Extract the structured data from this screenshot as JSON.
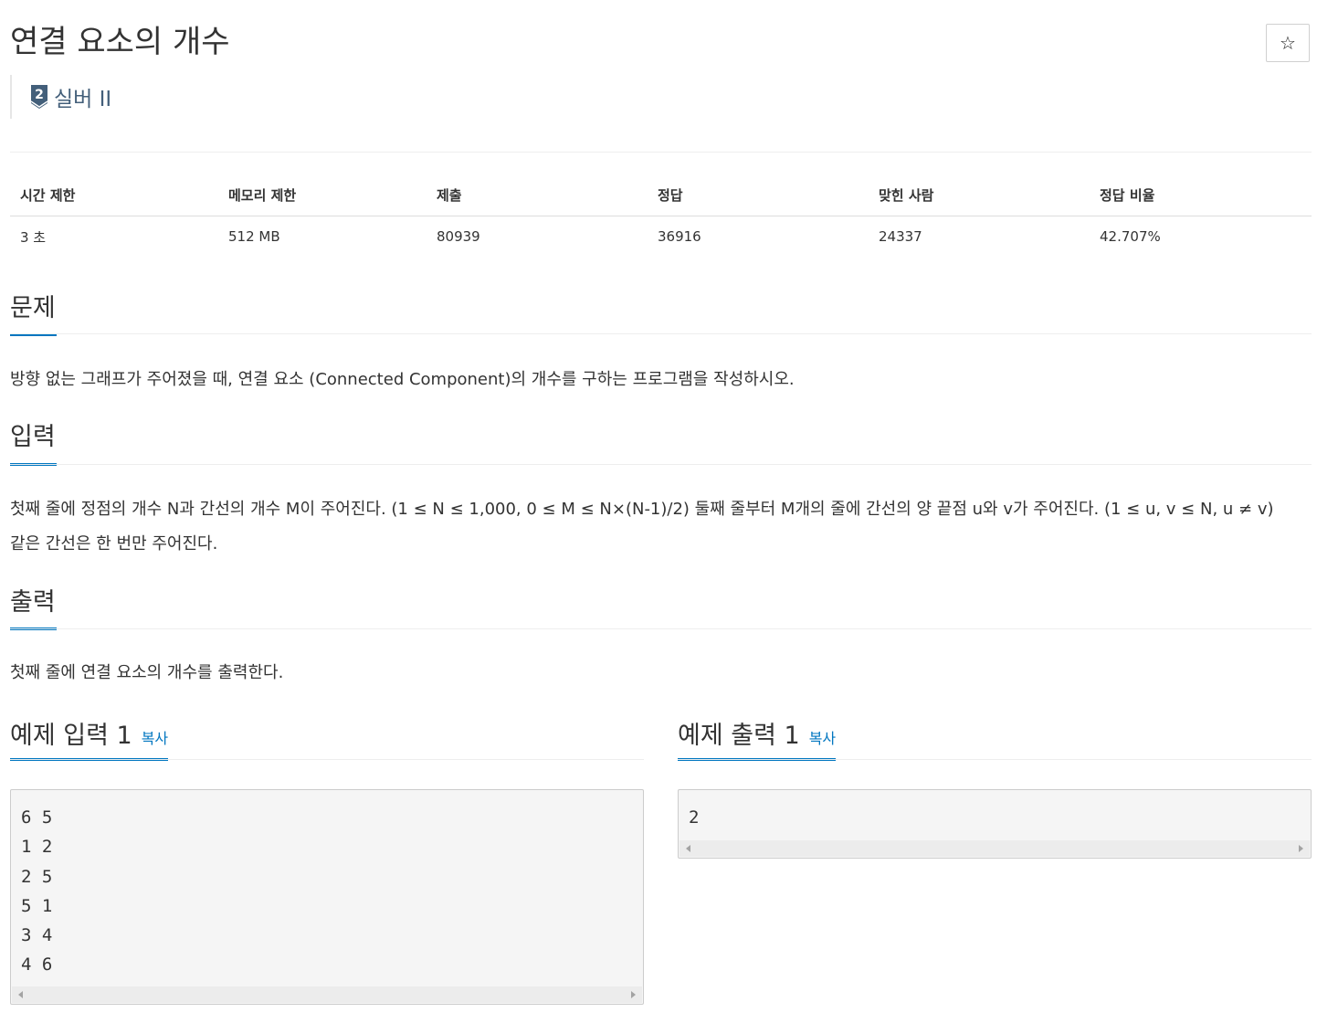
{
  "problem": {
    "title": "연결 요소의 개수",
    "star_icon": "☆",
    "tier": {
      "badge_number": "2",
      "label": "실버 II",
      "color": "#435f7a"
    }
  },
  "info_table": {
    "headers": [
      "시간 제한",
      "메모리 제한",
      "제출",
      "정답",
      "맞힌 사람",
      "정답 비율"
    ],
    "values": [
      "3 초",
      "512 MB",
      "80939",
      "36916",
      "24337",
      "42.707%"
    ]
  },
  "sections": {
    "problem": {
      "heading": "문제",
      "text": "방향 없는 그래프가 주어졌을 때, 연결 요소 (Connected Component)의 개수를 구하는 프로그램을 작성하시오."
    },
    "input": {
      "heading": "입력",
      "text": "첫째 줄에 정점의 개수 N과 간선의 개수 M이 주어진다. (1 ≤ N ≤ 1,000, 0 ≤ M ≤ N×(N-1)/2) 둘째 줄부터 M개의 줄에 간선의 양 끝점 u와 v가 주어진다. (1 ≤ u, v ≤ N, u ≠ v) 같은 간선은 한 번만 주어진다."
    },
    "output": {
      "heading": "출력",
      "text": "첫째 줄에 연결 요소의 개수를 출력한다."
    }
  },
  "samples": {
    "input": {
      "title": "예제 입력 1",
      "copy_label": "복사",
      "lines": [
        "6 5",
        "1 2",
        "2 5",
        "5 1",
        "3 4",
        "4 6"
      ]
    },
    "output": {
      "title": "예제 출력 1",
      "copy_label": "복사",
      "lines": [
        "2"
      ]
    }
  },
  "colors": {
    "accent": "#0076c0",
    "text": "#333333",
    "pre_background": "#f5f5f5"
  }
}
